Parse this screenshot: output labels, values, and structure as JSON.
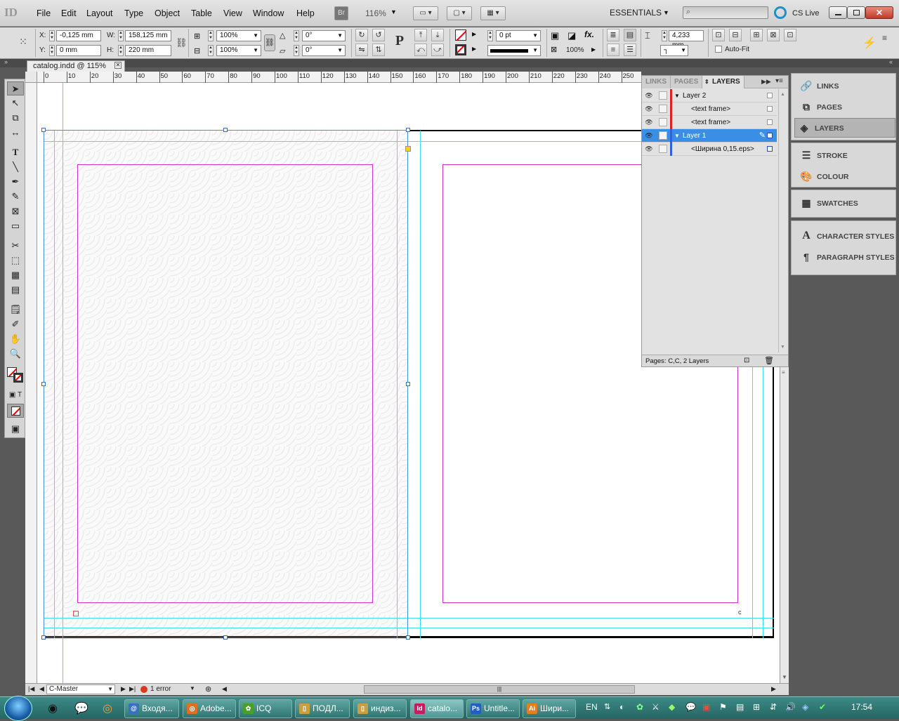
{
  "app": {
    "logo": "ID",
    "menu": [
      "File",
      "Edit",
      "Layout",
      "Type",
      "Object",
      "Table",
      "View",
      "Window",
      "Help"
    ],
    "bridge_label": "Br",
    "zoom": "116%",
    "workspace": "ESSENTIALS",
    "search_placeholder": "",
    "cs_live": "CS Live"
  },
  "control": {
    "x_label": "X:",
    "x_value": "-0,125 mm",
    "y_label": "Y:",
    "y_value": "0 mm",
    "w_label": "W:",
    "w_value": "158,125 mm",
    "h_label": "H:",
    "h_value": "220 mm",
    "scale_x": "100%",
    "scale_y": "100%",
    "rotate": "0°",
    "shear": "0°",
    "stroke_weight": "0 pt",
    "opacity": "100%",
    "fit_value": "4,233 mm",
    "autofit_label": "Auto-Fit"
  },
  "document": {
    "tab_title": "catalog.indd @ 115%",
    "ruler_labels": [
      "0",
      "10",
      "20",
      "30",
      "40",
      "50",
      "60",
      "70",
      "80",
      "90",
      "100",
      "110",
      "120",
      "130",
      "140",
      "150",
      "160",
      "170",
      "180",
      "190",
      "200",
      "210",
      "220",
      "230",
      "240",
      "250"
    ]
  },
  "layers_panel": {
    "tabs": [
      "LINKS",
      "PAGES",
      "LAYERS"
    ],
    "rows": [
      {
        "name": "Layer 2",
        "kind": "layer",
        "color": "#e02020"
      },
      {
        "name": "<text frame>",
        "kind": "item",
        "color": "#e02020"
      },
      {
        "name": "<text frame>",
        "kind": "item",
        "color": "#e02020"
      },
      {
        "name": "Layer 1",
        "kind": "layer",
        "color": "#3060e0",
        "selected": true
      },
      {
        "name": "<Ширина 0,15.eps>",
        "kind": "item",
        "color": "#3060e0"
      }
    ],
    "footer": "Pages: C,C, 2 Layers"
  },
  "dock": {
    "group1": [
      "LINKS",
      "PAGES",
      "LAYERS"
    ],
    "group2": [
      "STROKE",
      "COLOUR"
    ],
    "group3": [
      "SWATCHES"
    ],
    "group4": [
      "CHARACTER STYLES",
      "PARAGRAPH STYLES"
    ]
  },
  "status": {
    "page": "C-Master",
    "errors": "1 error"
  },
  "taskbar": {
    "tasks": [
      "Входя...",
      "Adobe...",
      "ICQ",
      "ПОДЛ...",
      "индиз...",
      "catalo...",
      "Untitle...",
      "Шири..."
    ],
    "lang": "EN",
    "time": "17:54"
  }
}
